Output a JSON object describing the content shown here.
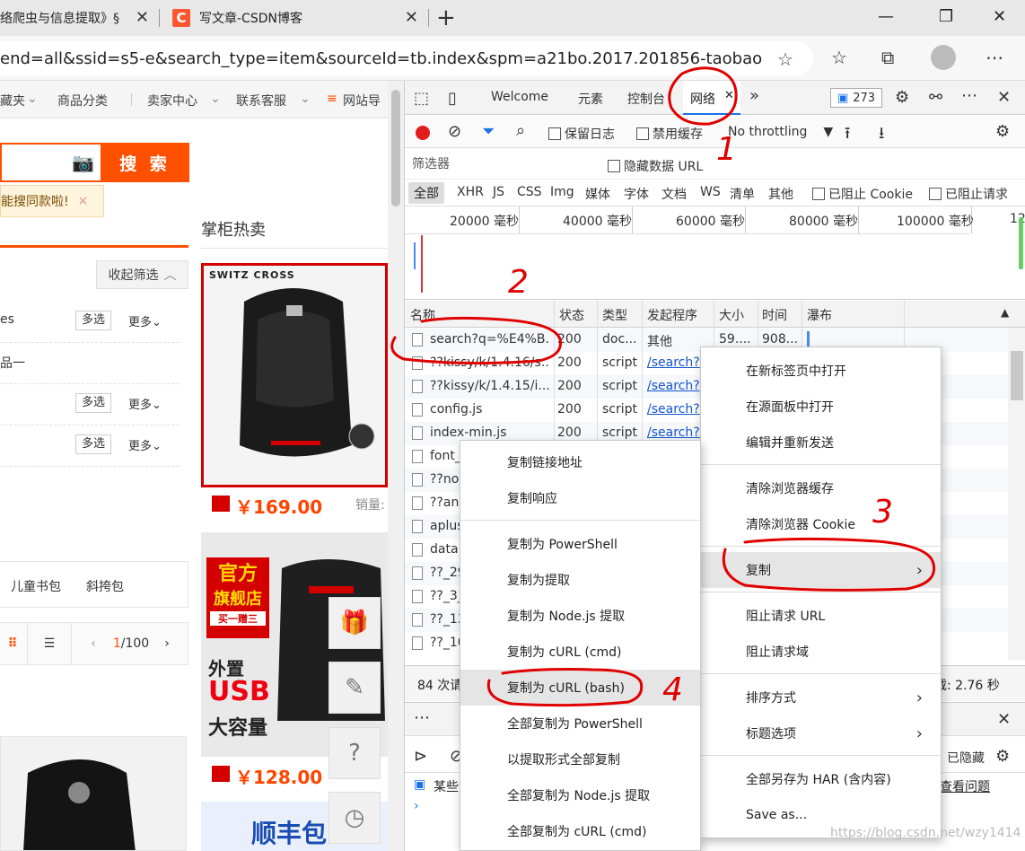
{
  "browser": {
    "tab1_title": "络爬虫与信息提取》§",
    "tab2_logo": "C",
    "tab2_title": "写文章-CSDN博客",
    "url": "end=all&ssid=s5-e&search_type=item&sourceId=tb.index&spm=a21bo.2017.201856-taobao-..."
  },
  "page": {
    "topnav": [
      "藏夹",
      "商品分类",
      "卖家中心",
      "联系客服",
      "网站导"
    ],
    "search_btn": "搜 索",
    "hint": "能搜同款啦!",
    "hint_close": "×",
    "hot_title": "掌柜热卖",
    "collapse_label": "收起筛选",
    "filters": [
      {
        "text": "es",
        "multi": "多选",
        "more": "更多"
      },
      {
        "text": "品一",
        "multi": "",
        "more": ""
      },
      {
        "text": "",
        "multi": "多选",
        "more": "更多"
      },
      {
        "text": "",
        "multi": "多选",
        "more": "更多"
      }
    ],
    "categories": [
      "儿童书包",
      "斜挎包"
    ],
    "pager": {
      "current": "1",
      "total": "/100"
    },
    "product1": {
      "brand": "SWITZ CROSS",
      "price": "￥169.00",
      "sold": "销量:"
    },
    "product2": {
      "badge1": "官方",
      "badge2": "旗舰店",
      "badge3": "买一赠三",
      "promo1": "外置",
      "promo2": "USB",
      "promo3": "大容量",
      "price": "￥128.00"
    },
    "product4": {
      "text": "顺丰包"
    }
  },
  "devtools": {
    "tabs": [
      "Welcome",
      "元素",
      "控制台",
      "网络"
    ],
    "more_tabs": "»",
    "issue_count": "273",
    "toolbar": {
      "preserve_log": "保留日志",
      "disable_cache": "禁用缓存",
      "throttling": "No throttling"
    },
    "filter_placeholder": "筛选器",
    "hide_data_url": "隐藏数据 URL",
    "types": [
      "全部",
      "XHR",
      "JS",
      "CSS",
      "Img",
      "媒体",
      "字体",
      "文档",
      "WS",
      "清单",
      "其他"
    ],
    "blocked_cookie": "已阻止 Cookie",
    "blocked_req": "已阻止请求",
    "timeline_ticks": [
      "20000 毫秒",
      "40000 毫秒",
      "60000 毫秒",
      "80000 毫秒",
      "100000 毫秒",
      "12"
    ],
    "columns": [
      "名称",
      "状态",
      "类型",
      "发起程序",
      "大小",
      "时间",
      "瀑布"
    ],
    "rows": [
      {
        "name": "search?q=%E4%B...",
        "status": "200",
        "type": "doc...",
        "initiator": "其他",
        "size": "59....",
        "time": "908..."
      },
      {
        "name": "??kissy/k/1.4.16/s...",
        "status": "200",
        "type": "script",
        "initiator": "/search?",
        "size": "",
        "time": ""
      },
      {
        "name": "??kissy/k/1.4.15/i...",
        "status": "200",
        "type": "script",
        "initiator": "/search?",
        "size": "",
        "time": ""
      },
      {
        "name": "config.js",
        "status": "200",
        "type": "script",
        "initiator": "/search?",
        "size": "",
        "time": ""
      },
      {
        "name": "index-min.js",
        "status": "200",
        "type": "script",
        "initiator": "/search?",
        "size": "",
        "time": ""
      },
      {
        "name": "font_",
        "status": "",
        "type": "",
        "initiator": "",
        "size": "",
        "time": ""
      },
      {
        "name": "??no",
        "status": "",
        "type": "",
        "initiator": "",
        "size": "",
        "time": ""
      },
      {
        "name": "??ani",
        "status": "",
        "type": "",
        "initiator": "",
        "size": "",
        "time": ""
      },
      {
        "name": "aplus",
        "status": "",
        "type": "",
        "initiator": "",
        "size": "",
        "time": ""
      },
      {
        "name": "data:",
        "status": "",
        "type": "",
        "initiator": "",
        "size": "",
        "time": ""
      },
      {
        "name": "??_29",
        "status": "",
        "type": "",
        "initiator": "",
        "size": "",
        "time": ""
      },
      {
        "name": "??_3_",
        "status": "",
        "type": "",
        "initiator": "",
        "size": "",
        "time": ""
      },
      {
        "name": "??_13",
        "status": "",
        "type": "",
        "initiator": "",
        "size": "",
        "time": ""
      },
      {
        "name": "??_10",
        "status": "",
        "type": "",
        "initiator": "",
        "size": "",
        "time": ""
      }
    ],
    "status_left": "84 次请",
    "status_right": "载: 2.76 秒",
    "drawer_more": "⋯",
    "drawer_hidden": "已隐藏",
    "drawer_msg": "某些",
    "drawer_link": "查看问题"
  },
  "menu1": {
    "items": [
      "在新标签页中打开",
      "在源面板中打开",
      "编辑并重新发送",
      "清除浏览器缓存",
      "清除浏览器 Cookie",
      "复制",
      "阻止请求 URL",
      "阻止请求域",
      "排序方式",
      "标题选项",
      "全部另存为 HAR (含内容)",
      "Save as..."
    ]
  },
  "menu2": {
    "items": [
      "复制链接地址",
      "复制响应",
      "复制为 PowerShell",
      "复制为提取",
      "复制为 Node.js 提取",
      "复制为 cURL (cmd)",
      "复制为 cURL (bash)",
      "全部复制为 PowerShell",
      "以提取形式全部复制",
      "全部复制为 Node.js 提取",
      "全部复制为 cURL (cmd)"
    ]
  },
  "annotations": {
    "n1": "1",
    "n2": "2",
    "n3": "3",
    "n4": "4"
  },
  "watermark": "https://blog.csdn.net/wzy1414",
  "colors": {
    "accent": "#ff5000",
    "annotation": "#e00000",
    "link": "#1155cc"
  }
}
